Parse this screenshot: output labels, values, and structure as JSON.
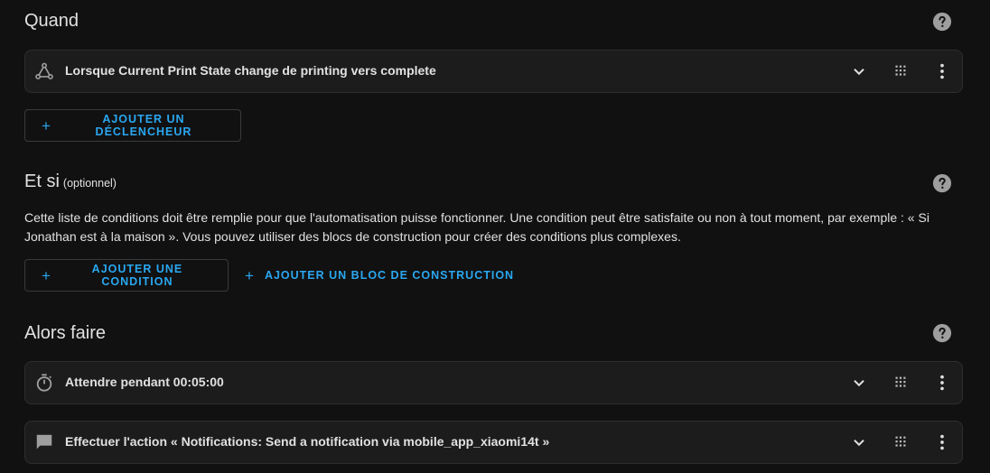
{
  "colors": {
    "background": "#111111",
    "card": "#1c1c1c",
    "accent": "#2aa7f0",
    "text": "#e1e1e1",
    "icon": "#9e9e9e"
  },
  "triggers": {
    "title": "Quand",
    "items": [
      {
        "icon": "trigger-icon",
        "text": "Lorsque Current Print State change de printing vers complete"
      }
    ],
    "add_button": "AJOUTER UN DÉCLENCHEUR"
  },
  "conditions": {
    "title": "Et si",
    "optional": "(optionnel)",
    "description": "Cette liste de conditions doit être remplie pour que l'automatisation puisse fonctionner. Une condition peut être satisfaite ou non à tout moment, par exemple : « Si Jonathan est à la maison ». Vous pouvez utiliser des blocs de construction pour créer des conditions plus complexes.",
    "add_condition_button": "AJOUTER UNE CONDITION",
    "add_block_button": "AJOUTER UN BLOC DE CONSTRUCTION"
  },
  "actions": {
    "title": "Alors faire",
    "items": [
      {
        "icon": "timer-icon",
        "text": "Attendre pendant 00:05:00"
      },
      {
        "icon": "message-icon",
        "text": "Effectuer l'action « Notifications: Send a notification via mobile_app_xiaomi14t »"
      }
    ]
  }
}
